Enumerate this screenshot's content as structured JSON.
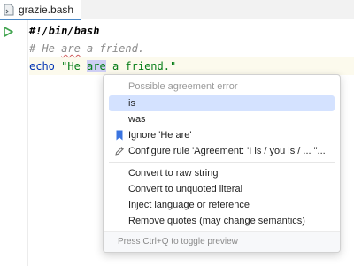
{
  "tab": {
    "filename": "grazie.bash"
  },
  "editor": {
    "line1": "#!/bin/bash",
    "line2": {
      "prefix": "# He ",
      "flagged": "are",
      "suffix": " a friend."
    },
    "line3": {
      "keyword": "echo",
      "space": " ",
      "str_open": "\"He ",
      "selected": "are",
      "str_close": " a friend.\""
    }
  },
  "popup": {
    "header": "Possible agreement error",
    "suggestions": [
      "is",
      "was"
    ],
    "ignore_rule": "Ignore 'He are'",
    "configure_rule": "Configure rule 'Agreement: 'I is / you is / ... \"...",
    "actions": [
      "Convert to raw string",
      "Convert to unquoted literal",
      "Inject language or reference",
      "Remove quotes (may change semantics)"
    ],
    "footer": "Press Ctrl+Q to toggle preview"
  },
  "colors": {
    "selection": "#d4e2ff",
    "keyword": "#0033b3",
    "string": "#067d17",
    "comment": "#8c8c8c",
    "bookmark": "#3b74e0",
    "run": "#3fa34d"
  }
}
